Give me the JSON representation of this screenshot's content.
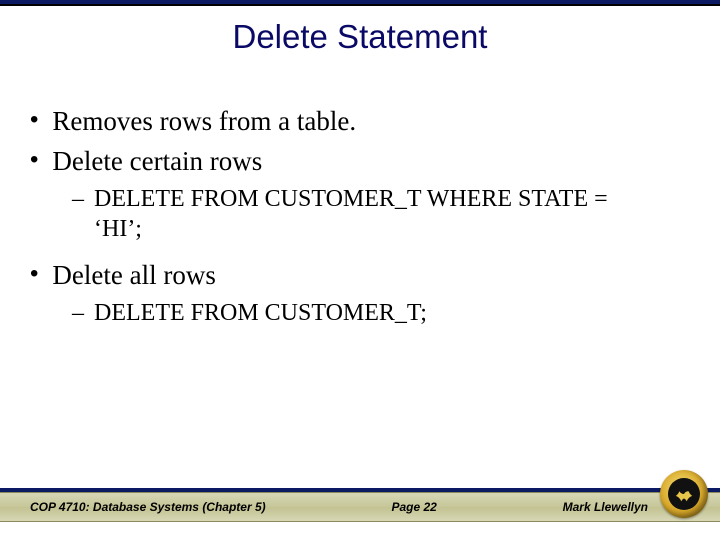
{
  "title": "Delete Statement",
  "bullets": {
    "b1": "Removes rows from a table.",
    "b2": "Delete certain rows",
    "b2_sub": "DELETE FROM CUSTOMER_T WHERE STATE = ‘HI’;",
    "b3": "Delete all rows",
    "b3_sub": "DELETE FROM CUSTOMER_T;"
  },
  "footer": {
    "left": "COP 4710: Database Systems  (Chapter 5)",
    "center": "Page 22",
    "right": "Mark Llewellyn"
  }
}
